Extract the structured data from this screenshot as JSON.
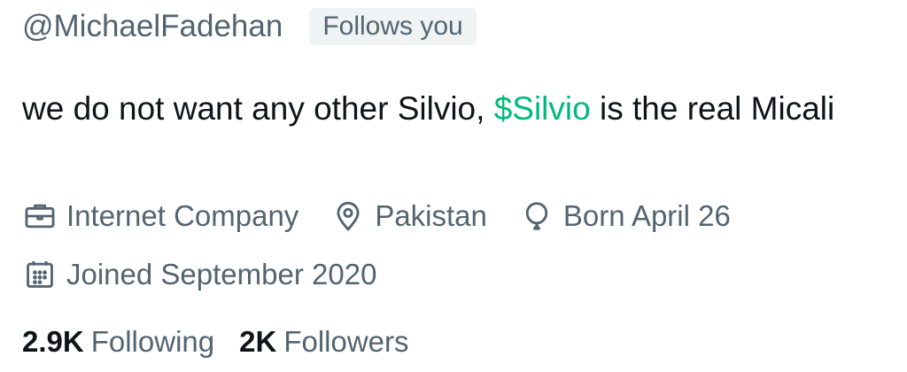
{
  "profile": {
    "handle": "@MichaelFadehan",
    "follows_you_badge": "Follows you",
    "bio": {
      "before": "we do not want any other Silvio, ",
      "cashtag": "$Silvio",
      "after": " is the real Micali"
    },
    "meta": {
      "profession": {
        "icon": "briefcase-icon",
        "text": "Internet Company"
      },
      "location": {
        "icon": "location-pin-icon",
        "text": "Pakistan"
      },
      "birthday": {
        "icon": "balloon-icon",
        "text": "Born April 26"
      },
      "joined": {
        "icon": "calendar-icon",
        "text": "Joined September 2020"
      }
    },
    "stats": {
      "following_count": "2.9K",
      "following_label": "Following",
      "followers_count": "2K",
      "followers_label": "Followers"
    }
  },
  "colors": {
    "text_primary": "#0f1419",
    "text_secondary": "#536471",
    "cashtag": "#00ba7c",
    "badge_bg": "#eff3f4"
  }
}
